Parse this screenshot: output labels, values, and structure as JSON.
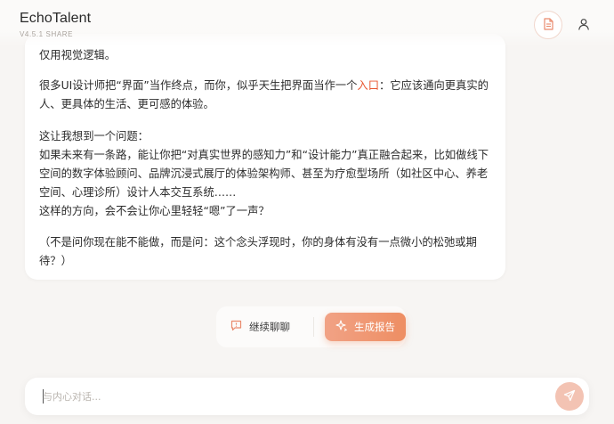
{
  "app": {
    "name": "EchoTalent",
    "version": "V4.5.1 SHARE"
  },
  "header": {
    "report_icon": "document-icon",
    "user_icon": "user-icon"
  },
  "message": {
    "line0": "仅用视觉逻辑。",
    "p1_before": "很多UI设计师把“界面”当作终点，而你，似乎天生把界面当作一个",
    "p1_highlight": "入口",
    "p1_after": "：它应该通向更真实的人、更具体的生活、更可感的体验。",
    "p2": "这让我想到一个问题：\n如果未来有一条路，能让你把“对真实世界的感知力”和“设计能力”真正融合起来，比如做线下空间的数字体验顾问、品牌沉浸式展厅的体验架构师、甚至为疗愈型场所（如社区中心、养老空间、心理诊所）设计人本交互系统……\n这样的方向，会不会让你心里轻轻“嗯”了一声？",
    "p3": "（不是问你现在能不能做，而是问：这个念头浮现时，你的身体有没有一点微小的松弛或期待？）"
  },
  "actions": {
    "continue_label": "继续聊聊",
    "continue_icon": "chat-icon",
    "generate_label": "生成报告",
    "generate_icon": "sparkle-icon"
  },
  "input": {
    "placeholder": "与内心对话...",
    "value": "",
    "send_icon": "send-icon"
  },
  "colors": {
    "accent": "#e8552f",
    "button_gradient_start": "#f1a285",
    "button_gradient_end": "#ee8e63",
    "send_button": "#f3c3b3"
  }
}
